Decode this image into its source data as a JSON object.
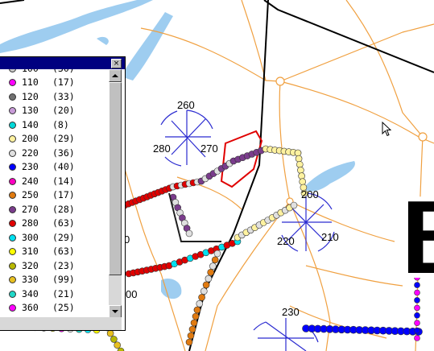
{
  "map": {
    "labels": {
      "wind_rose_1_north": "260",
      "wind_rose_1_west": "280",
      "wind_rose_1_east": "270",
      "wind_rose_2_north": "200",
      "wind_rose_2_west": "220",
      "wind_rose_2_east": "210",
      "wind_rose_3_north": "230",
      "partial_left_1": "0",
      "partial_left_2": "00"
    },
    "big_letter": "E",
    "colors": {
      "road": "#f0a040",
      "water": "#9ecdf0",
      "boundary": "#000000",
      "wind_rose": "#2b2bd0",
      "highlight": "#e00000"
    }
  },
  "legend": {
    "partial_top": {
      "value": "100",
      "count": "(30)",
      "color": "#c8c8c8"
    },
    "items": [
      {
        "value": "110",
        "count": "(17)",
        "color": "#ff00ff"
      },
      {
        "value": "120",
        "count": "(33)",
        "color": "#707070"
      },
      {
        "value": "130",
        "count": "(20)",
        "color": "#c89bd8"
      },
      {
        "value": "140",
        "count": " (8)",
        "color": "#00d8d8"
      },
      {
        "value": "200",
        "count": "(29)",
        "color": "#fff2a0"
      },
      {
        "value": "220",
        "count": "(36)",
        "color": "#e0e0e0"
      },
      {
        "value": "230",
        "count": "(40)",
        "color": "#0000ff"
      },
      {
        "value": "240",
        "count": "(14)",
        "color": "#ff00c0"
      },
      {
        "value": "250",
        "count": "(17)",
        "color": "#e07a10"
      },
      {
        "value": "270",
        "count": "(28)",
        "color": "#7a3c8c"
      },
      {
        "value": "280",
        "count": "(63)",
        "color": "#e00000"
      },
      {
        "value": "300",
        "count": "(29)",
        "color": "#00e0f0"
      },
      {
        "value": "310",
        "count": "(63)",
        "color": "#ffff00"
      },
      {
        "value": "320",
        "count": "(23)",
        "color": "#b8b800"
      },
      {
        "value": "330",
        "count": "(99)",
        "color": "#e8c020"
      },
      {
        "value": "340",
        "count": "(21)",
        "color": "#20d8c8"
      },
      {
        "value": "360",
        "count": "(25)",
        "color": "#ff00ff"
      }
    ],
    "close_glyph": "×"
  }
}
